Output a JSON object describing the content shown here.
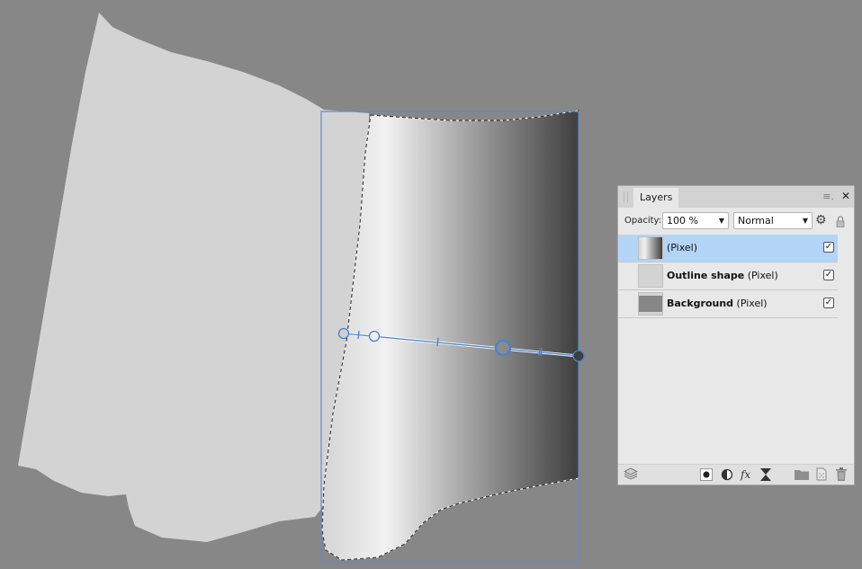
{
  "canvas": {
    "background_color": "#878787",
    "outline_shape_color": "#d3d3d3",
    "selection_color": "#5b8bd1",
    "gradient_stops": [
      {
        "offset": 0.0,
        "color": "#d4d4d4"
      },
      {
        "offset": 0.25,
        "color": "#f2f2f2"
      },
      {
        "offset": 0.55,
        "color": "#a8a8a8"
      },
      {
        "offset": 1.0,
        "color": "#3e3e3e"
      }
    ]
  },
  "layers_panel": {
    "tab_label": "Layers",
    "menu_icon": "hamburger-menu-icon",
    "close_icon": "close-icon",
    "opacity_label": "Opacity:",
    "opacity_value": "100 %",
    "blend_mode": "Normal",
    "layers": [
      {
        "name": "",
        "type": "(Pixel)",
        "visible": true,
        "selected": true,
        "thumb": "gradient"
      },
      {
        "name": "Outline shape",
        "type": "(Pixel)",
        "visible": true,
        "selected": false,
        "thumb": "light"
      },
      {
        "name": "Background",
        "type": "(Pixel)",
        "visible": true,
        "selected": false,
        "thumb": "dark"
      }
    ],
    "footer_icons": [
      "layers-stack-icon",
      "mask-icon",
      "adjustment-icon",
      "fx-icon",
      "live-filter-icon",
      "folder-icon",
      "new-layer-icon",
      "trash-icon"
    ],
    "check_glyph": "✓",
    "fx_label": "fx"
  }
}
